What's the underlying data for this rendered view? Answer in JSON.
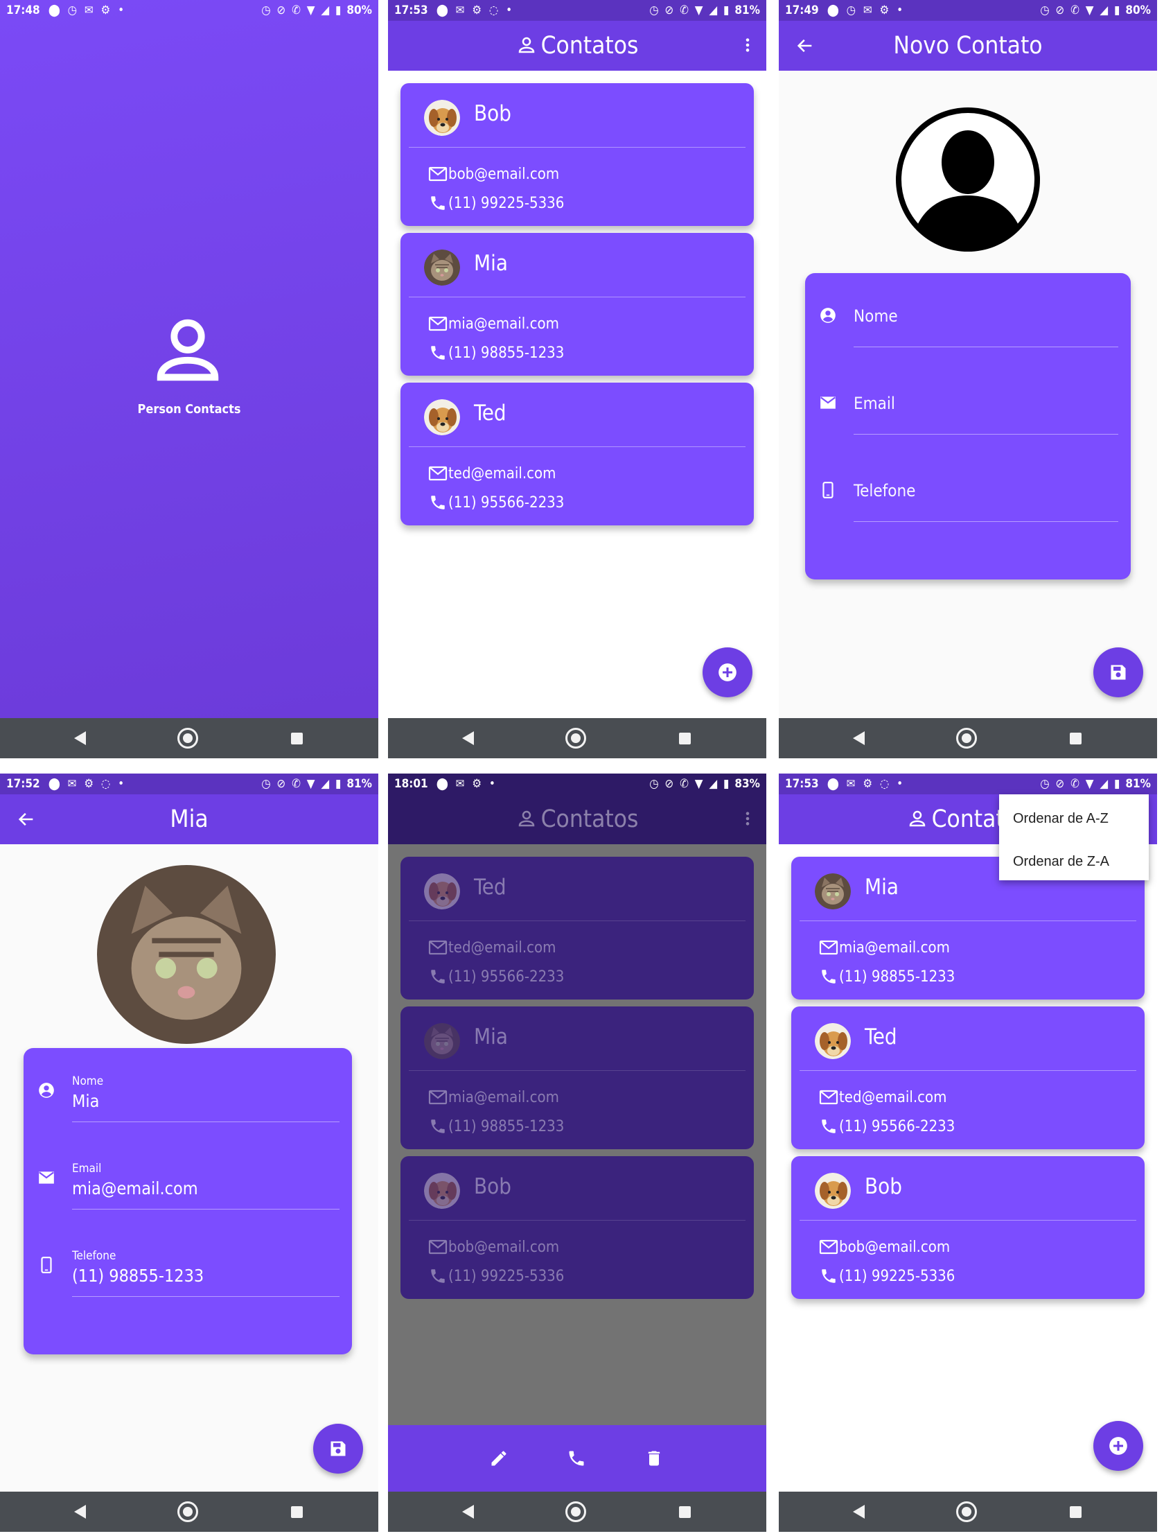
{
  "splash": {
    "status": {
      "time": "17:48",
      "battery": "80%"
    },
    "app_name": "Person Contacts",
    "colors": {
      "top": "#7b4af6",
      "bottom": "#6b3ad8"
    }
  },
  "list_screen": {
    "status": {
      "time": "17:53",
      "battery": "81%"
    },
    "title": "Contatos",
    "contacts": [
      {
        "name": "Bob",
        "email": "bob@email.com",
        "phone": "(11) 99225-5336",
        "avatar": "dog-avatar"
      },
      {
        "name": "Mia",
        "email": "mia@email.com",
        "phone": "(11) 98855-1233",
        "avatar": "cat-avatar"
      },
      {
        "name": "Ted",
        "email": "ted@email.com",
        "phone": "(11) 95566-2233",
        "avatar": "dog-avatar"
      }
    ]
  },
  "new_contact": {
    "status": {
      "time": "17:49",
      "battery": "80%"
    },
    "title": "Novo Contato",
    "fields": {
      "name": "Nome",
      "email": "Email",
      "phone": "Telefone"
    }
  },
  "edit_contact": {
    "status": {
      "time": "17:52",
      "battery": "81%"
    },
    "title": "Mia",
    "fields": {
      "name_label": "Nome",
      "name_value": "Mia",
      "email_label": "Email",
      "email_value": "mia@email.com",
      "phone_label": "Telefone",
      "phone_value": "(11) 98855-1233"
    }
  },
  "options_sheet": {
    "status": {
      "time": "18:01",
      "battery": "83%"
    },
    "title": "Contatos",
    "contacts": [
      {
        "name": "Ted",
        "email": "ted@email.com",
        "phone": "(11) 95566-2233"
      },
      {
        "name": "Mia",
        "email": "mia@email.com",
        "phone": "(11) 98855-1233"
      },
      {
        "name": "Bob",
        "email": "bob@email.com",
        "phone": "(11) 99225-5336"
      }
    ],
    "actions": [
      "edit-icon",
      "phone-icon",
      "delete-icon"
    ]
  },
  "sort_menu": {
    "status": {
      "time": "17:53",
      "battery": "81%"
    },
    "title": "Contatos",
    "menu": [
      "Ordenar de A-Z",
      "Ordenar de Z-A"
    ],
    "contacts": [
      {
        "name": "Mia",
        "email": "mia@email.com",
        "phone": "(11) 98855-1233"
      },
      {
        "name": "Ted",
        "email": "ted@email.com",
        "phone": "(11) 95566-2233"
      },
      {
        "name": "Bob",
        "email": "bob@email.com",
        "phone": "(11) 99225-5336"
      }
    ]
  },
  "colors": {
    "primary": "#6d3ee4",
    "card": "#7c4dff",
    "nav": "#494d52"
  }
}
